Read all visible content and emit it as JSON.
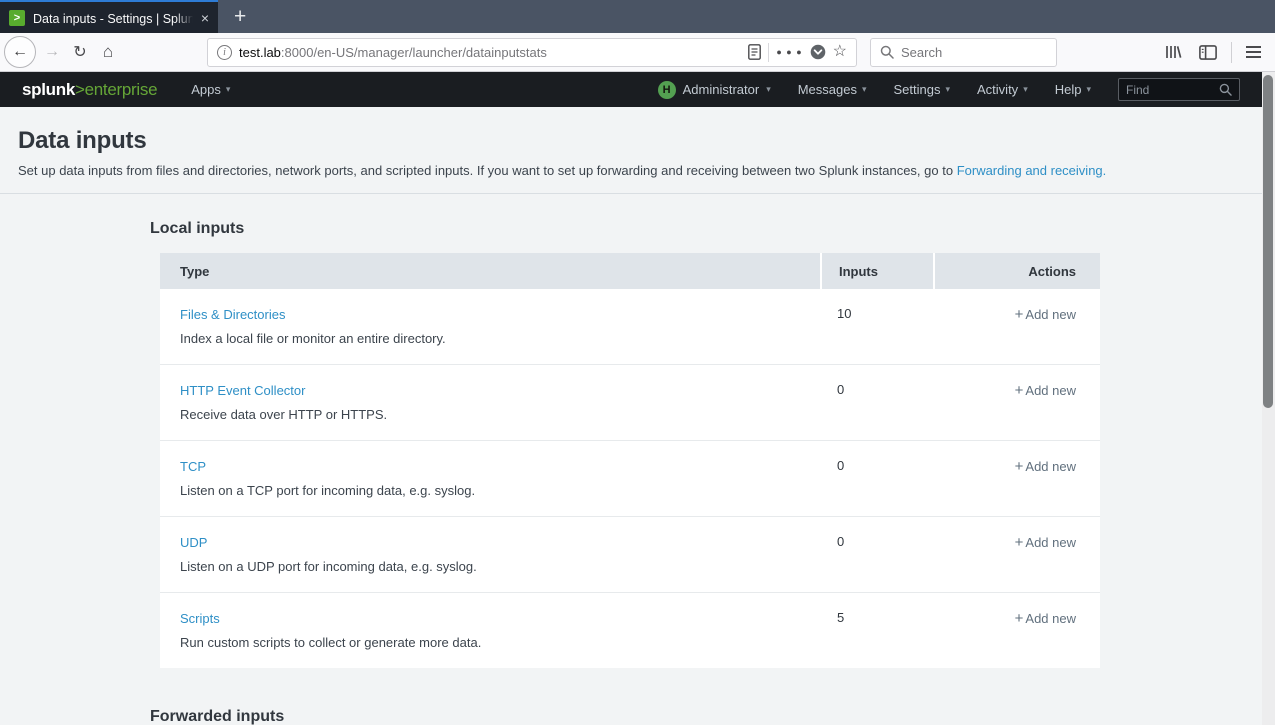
{
  "browser": {
    "tab": {
      "title": "Data inputs - Settings | Splun",
      "favicon_glyph": ">",
      "close_glyph": "×",
      "new_tab_glyph": "+"
    },
    "toolbar": {
      "back_glyph": "←",
      "forward_glyph": "→",
      "refresh_glyph": "↻",
      "home_glyph": "⌂",
      "info_glyph": "i",
      "url_host": "test.lab",
      "url_path": ":8000/en-US/manager/launcher/datainputstats",
      "overflow_glyph": "● ● ●",
      "star_glyph": "☆",
      "search_placeholder": "Search"
    }
  },
  "navbar": {
    "logo_primary": "splunk",
    "logo_secondary": ">enterprise",
    "caret_glyph": "▾",
    "apps": {
      "label": "Apps"
    },
    "user": {
      "avatar_letter": "H",
      "label": "Administrator"
    },
    "menus": [
      {
        "label": "Messages"
      },
      {
        "label": "Settings"
      },
      {
        "label": "Activity"
      },
      {
        "label": "Help"
      }
    ],
    "find_placeholder": "Find"
  },
  "page": {
    "title": "Data inputs",
    "description_text": "Set up data inputs from files and directories, network ports, and scripted inputs. If you want to set up forwarding and receiving between two Splunk instances, go to ",
    "description_link": "Forwarding and receiving.",
    "local_section_title": "Local inputs",
    "forwarded_section_title": "Forwarded inputs",
    "table": {
      "headers": [
        "Type",
        "Inputs",
        "Actions"
      ],
      "add_new_plus": "+",
      "rows": [
        {
          "type": "Files & Directories",
          "description": "Index a local file or monitor an entire directory.",
          "inputs": "10",
          "action": "Add new"
        },
        {
          "type": "HTTP Event Collector",
          "description": "Receive data over HTTP or HTTPS.",
          "inputs": "0",
          "action": "Add new"
        },
        {
          "type": "TCP",
          "description": "Listen on a TCP port for incoming data, e.g. syslog.",
          "inputs": "0",
          "action": "Add new"
        },
        {
          "type": "UDP",
          "description": "Listen on a UDP port for incoming data, e.g. syslog.",
          "inputs": "0",
          "action": "Add new"
        },
        {
          "type": "Scripts",
          "description": "Run custom scripts to collect or generate more data.",
          "inputs": "5",
          "action": "Add new"
        }
      ]
    }
  },
  "colors": {
    "accent_green": "#65a637",
    "link_blue": "#2e8fc6",
    "navbar_bg": "#1a1d21",
    "tab_active_stripe": "#2e7cd6",
    "table_header_bg": "#dfe4e9"
  }
}
